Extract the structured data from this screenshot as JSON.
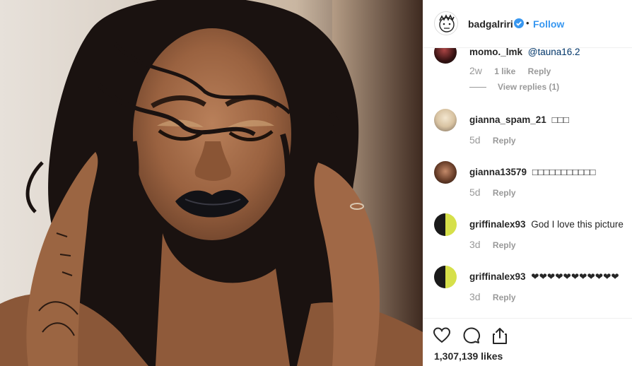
{
  "post": {
    "username": "badgalriri",
    "dot": "•",
    "follow_label": "Follow",
    "likes_text": "1,307,139 likes"
  },
  "comments": [
    {
      "username": "momo._lmk",
      "text": "@tauna16.2",
      "time": "2w",
      "likes": "1 like",
      "reply": "Reply",
      "view_replies": "View replies (1)"
    },
    {
      "username": "gianna_spam_21",
      "text": "□□□",
      "time": "5d",
      "reply": "Reply"
    },
    {
      "username": "gianna13579",
      "text": "□□□□□□□□□□□",
      "time": "5d",
      "reply": "Reply"
    },
    {
      "username": "griffinalex93",
      "text": "God I love this picture",
      "time": "3d",
      "reply": "Reply"
    },
    {
      "username": "griffinalex93",
      "text": "❤❤❤❤❤❤❤❤❤❤❤",
      "time": "3d",
      "reply": "Reply"
    }
  ],
  "icons": {
    "like": "heart-icon",
    "comment": "comment-icon",
    "share": "share-icon",
    "verified": "verified-badge-icon"
  },
  "colors": {
    "accent": "#3897f0",
    "text": "#262626",
    "muted": "#999999",
    "mention": "#003569"
  }
}
